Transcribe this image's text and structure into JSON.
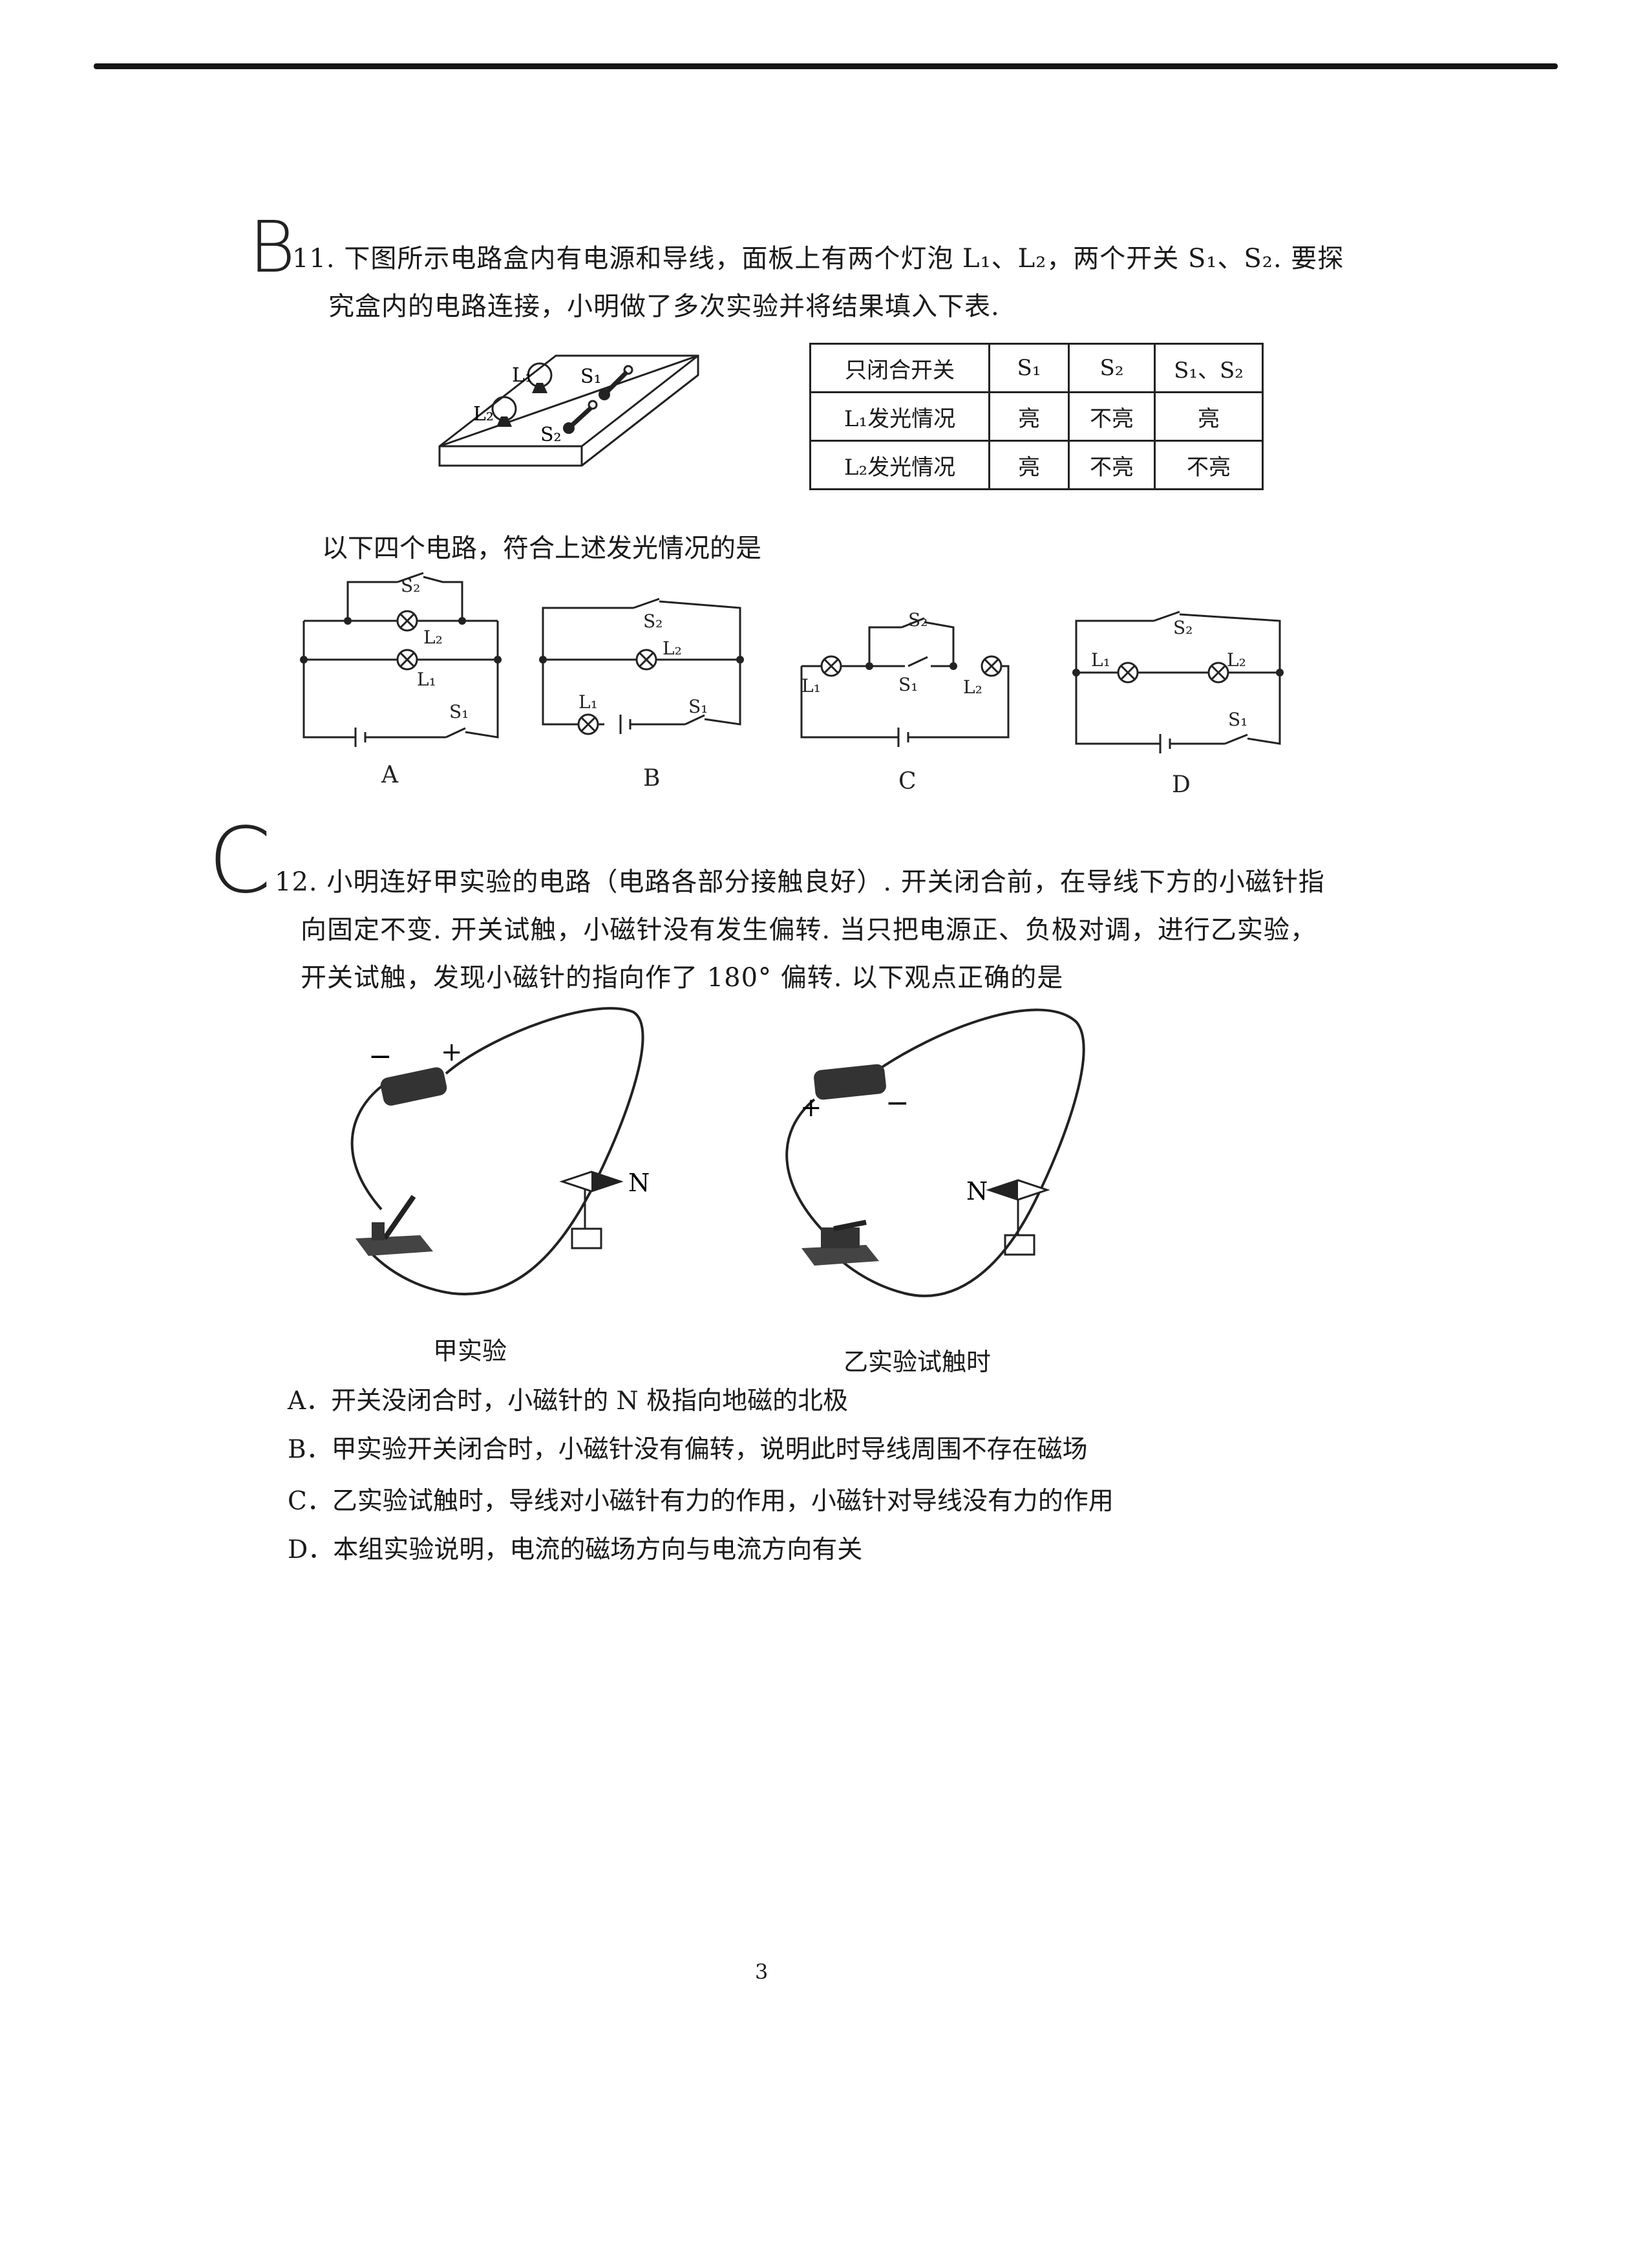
{
  "q11": {
    "handwritten_answer": "B",
    "number": "11.",
    "line1": "下图所示电路盒内有电源和导线，面板上有两个灯泡 L₁、L₂，两个开关 S₁、S₂. 要探",
    "line2": "究盒内的电路连接，小明做了多次实验并将结果填入下表.",
    "box_labels": {
      "l1": "L₁",
      "l2": "L₂",
      "s1": "S₁",
      "s2": "S₂"
    },
    "table": {
      "header": [
        "只闭合开关",
        "S₁",
        "S₂",
        "S₁、S₂"
      ],
      "rows": [
        [
          "L₁发光情况",
          "亮",
          "不亮",
          "亮"
        ],
        [
          "L₂发光情况",
          "亮",
          "不亮",
          "不亮"
        ]
      ]
    },
    "prompt": "以下四个电路，符合上述发光情况的是",
    "circuit_labels": {
      "l1": "L₁",
      "l2": "L₂",
      "s1": "S₁",
      "s2": "S₂"
    },
    "options": [
      "A",
      "B",
      "C",
      "D"
    ]
  },
  "q12": {
    "handwritten_answer": "C",
    "number": "12.",
    "line1": "小明连好甲实验的电路（电路各部分接触良好）. 开关闭合前，在导线下方的小磁针指",
    "line2": "向固定不变. 开关试触，小磁针没有发生偏转. 当只把电源正、负极对调，进行乙实验，",
    "line3": "开关试触，发现小磁针的指向作了 180° 偏转. 以下观点正确的是",
    "fig_jia": {
      "minus": "−",
      "plus": "+",
      "north": "N",
      "caption": "甲实验"
    },
    "fig_yi": {
      "plus": "+",
      "minus": "−",
      "north": "N",
      "caption": "乙实验试触时"
    },
    "choices": [
      "A．开关没闭合时，小磁针的 N 极指向地磁的北极",
      "B．甲实验开关闭合时，小磁针没有偏转，说明此时导线周围不存在磁场",
      "C．乙实验试触时，导线对小磁针有力的作用，小磁针对导线没有力的作用",
      "D．本组实验说明，电流的磁场方向与电流方向有关"
    ]
  },
  "page_number": "3"
}
